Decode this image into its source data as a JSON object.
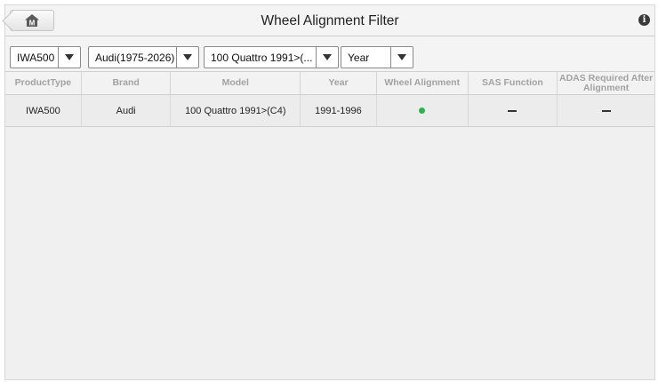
{
  "header": {
    "title": "Wheel Alignment Filter",
    "home_icon_letter": "M",
    "info_glyph": "i"
  },
  "filters": [
    {
      "value": "IWA500"
    },
    {
      "value": "Audi(1975-2026)"
    },
    {
      "value": "100 Quattro 1991>(..."
    },
    {
      "value": "Year"
    }
  ],
  "table": {
    "columns": [
      "ProductType",
      "Brand",
      "Model",
      "Year",
      "Wheel Alignment",
      "SAS Function",
      "ADAS Required After Alignment"
    ],
    "rows": [
      {
        "product_type": "IWA500",
        "brand": "Audi",
        "model": "100 Quattro 1991>(C4)",
        "year": "1991-1996",
        "wheel_alignment": {
          "status": "supported",
          "color": "#2db34a"
        },
        "sas_function": "not-applicable",
        "adas_required": "not-applicable"
      }
    ]
  },
  "colors": {
    "background": "#f0f0f0",
    "supported_dot": "#2db34a"
  }
}
